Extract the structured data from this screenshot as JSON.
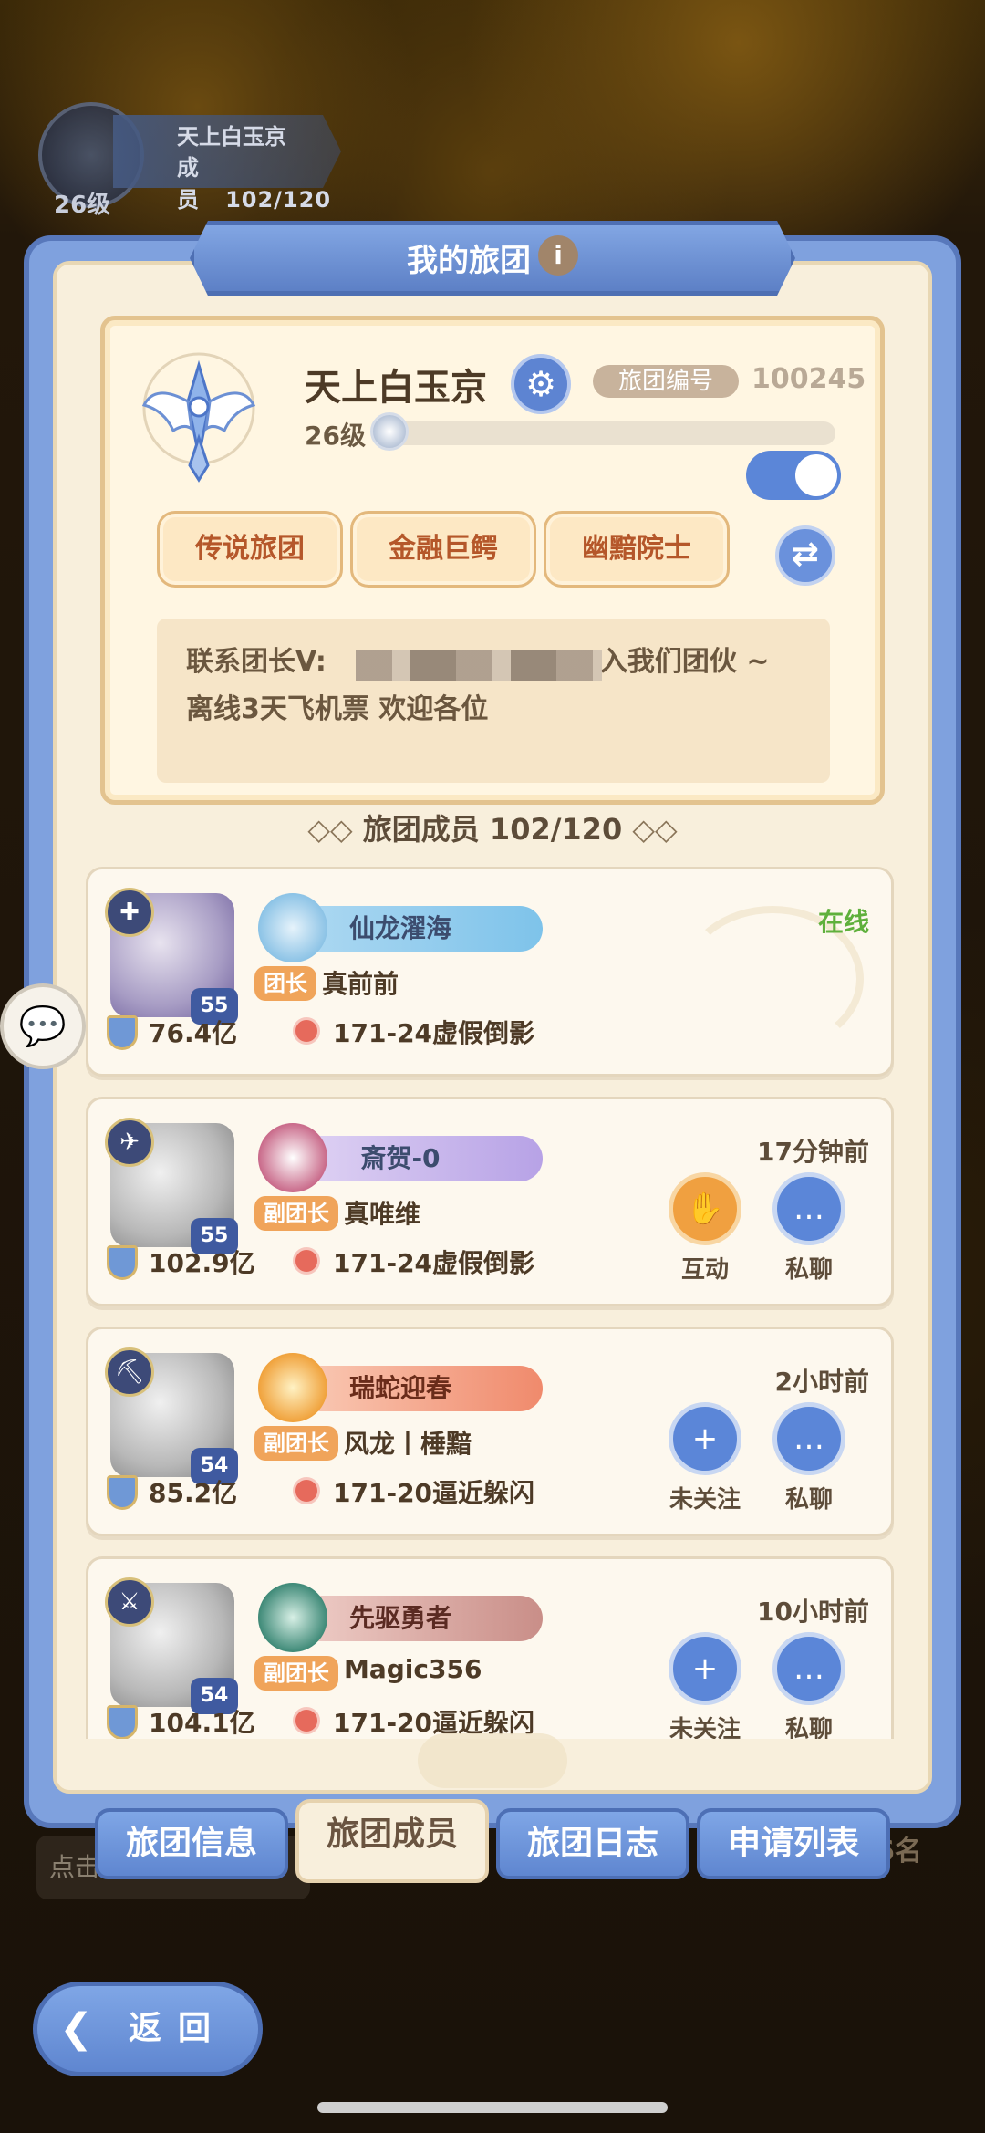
{
  "top_badge": {
    "guild_name": "天上白玉京",
    "members_label": "成员",
    "members_count": "102/120",
    "level": "26级"
  },
  "panel": {
    "title": "我的旅团",
    "info_icon": "i"
  },
  "guild": {
    "name": "天上白玉京",
    "id_label": "旅团编号",
    "id_value": "100245",
    "level": "26级",
    "level_progress": 0.05,
    "toggle_on": true,
    "tags": [
      "传说旅团",
      "金融巨鳄",
      "幽黯院士"
    ],
    "announcement_line1": "联系团长V:",
    "announcement_line1_end": "入我们团伙 ~",
    "announcement_line2": "离线3天飞机票  欢迎各位"
  },
  "members_header": {
    "label": "旅团成员 102/120",
    "deco_left": "◇◇",
    "deco_right": "◇◇"
  },
  "members": [
    {
      "rank_icon": "✚",
      "level": "55",
      "nameplate": "仙龙濯海",
      "role": "团长",
      "name": "真前前",
      "power": "76.4亿",
      "server": "171-24虚假倒影",
      "status": "在线"
    },
    {
      "rank_icon": "✈",
      "level": "55",
      "nameplate": "斎贺-0",
      "role": "副团长",
      "name": "真唯维",
      "power": "102.9亿",
      "server": "171-24虚假倒影",
      "status": "17分钟前",
      "action1": "互动",
      "action2": "私聊"
    },
    {
      "rank_icon": "⛏",
      "level": "54",
      "nameplate": "瑞蛇迎春",
      "role": "副团长",
      "name": "风龙丨棰黯",
      "power": "85.2亿",
      "server": "171-20逼近躲闪",
      "status": "2小时前",
      "action1": "未关注",
      "action2": "私聊"
    },
    {
      "rank_icon": "⚔",
      "level": "54",
      "nameplate": "先驱勇者",
      "role": "副团长",
      "name": "Magic356",
      "power": "104.1亿",
      "server": "171-20逼近躲闪",
      "status": "10小时前",
      "action1": "未关注",
      "action2": "私聊"
    }
  ],
  "tabs": [
    "旅团信息",
    "旅团成员",
    "旅团日志",
    "申请列表"
  ],
  "active_tab": "旅团成员",
  "back_button": {
    "chevron": "❮",
    "label": "返回"
  },
  "background_hint_left": "点击",
  "background_hint_right": "6名",
  "colors": {
    "panel_blue": "#7fa1de",
    "parchment": "#f8efdc",
    "online_green": "#5fb03c",
    "role_orange": "#f0a45a"
  }
}
